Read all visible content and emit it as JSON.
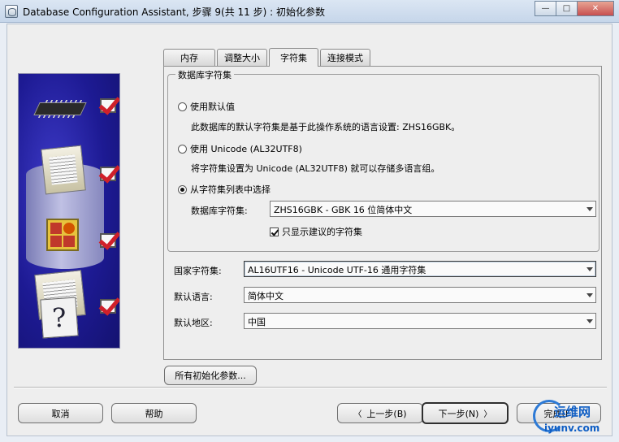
{
  "window": {
    "title": "Database Configuration Assistant, 步骤 9(共 11 步) : 初始化参数",
    "minimize": "—",
    "maximize": "□",
    "close": "✕"
  },
  "tabs": [
    {
      "label": "内存",
      "active": false
    },
    {
      "label": "调整大小",
      "active": false
    },
    {
      "label": "字符集",
      "active": true
    },
    {
      "label": "连接模式",
      "active": false
    }
  ],
  "charset": {
    "legend": "数据库字符集",
    "opt_default": "使用默认值",
    "opt_default_desc": "此数据库的默认字符集是基于此操作系统的语言设置: ZHS16GBK。",
    "opt_unicode": "使用 Unicode (AL32UTF8)",
    "opt_unicode_desc": "将字符集设置为 Unicode (AL32UTF8) 就可以存储多语言组。",
    "opt_list": "从字符集列表中选择",
    "db_charset_label": "数据库字符集:",
    "db_charset_value": "ZHS16GBK - GBK 16 位简体中文",
    "show_recommended": "只显示建议的字符集",
    "selected_option": "list",
    "show_recommended_checked": true
  },
  "national": {
    "national_label": "国家字符集:",
    "national_value": "AL16UTF16 - Unicode UTF-16 通用字符集",
    "language_label": "默认语言:",
    "language_value": "简体中文",
    "territory_label": "默认地区:",
    "territory_value": "中国"
  },
  "buttons": {
    "all_params": "所有初始化参数...",
    "cancel": "取消",
    "help": "帮助",
    "back": "上一步(B)",
    "next": "下一步(N)",
    "finish": "完成(F)"
  },
  "watermark": {
    "top": "运维网",
    "bottom": "iyunv.com"
  }
}
